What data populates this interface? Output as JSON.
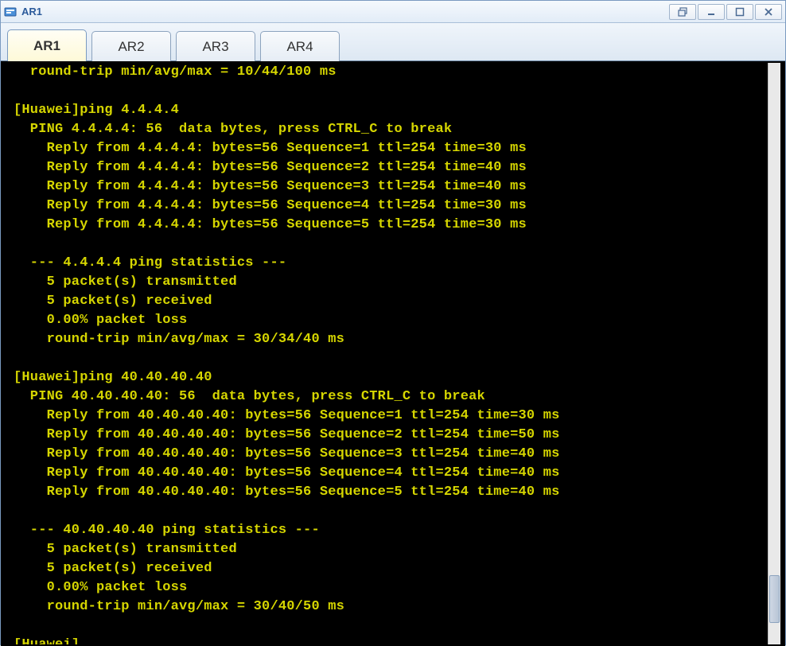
{
  "window": {
    "title": "AR1"
  },
  "tabs": [
    {
      "label": "AR1",
      "active": true
    },
    {
      "label": "AR2",
      "active": false
    },
    {
      "label": "AR3",
      "active": false
    },
    {
      "label": "AR4",
      "active": false
    }
  ],
  "terminal": {
    "partial_top": "  round-trip min/avg/max = 10/44/100 ms",
    "blocks": [
      {
        "prompt": "[Huawei]ping 4.4.4.4",
        "header": "  PING 4.4.4.4: 56  data bytes, press CTRL_C to break",
        "replies": [
          "    Reply from 4.4.4.4: bytes=56 Sequence=1 ttl=254 time=30 ms",
          "    Reply from 4.4.4.4: bytes=56 Sequence=2 ttl=254 time=40 ms",
          "    Reply from 4.4.4.4: bytes=56 Sequence=3 ttl=254 time=40 ms",
          "    Reply from 4.4.4.4: bytes=56 Sequence=4 ttl=254 time=30 ms",
          "    Reply from 4.4.4.4: bytes=56 Sequence=5 ttl=254 time=30 ms"
        ],
        "stats_header": "  --- 4.4.4.4 ping statistics ---",
        "stats": [
          "    5 packet(s) transmitted",
          "    5 packet(s) received",
          "    0.00% packet loss",
          "    round-trip min/avg/max = 30/34/40 ms"
        ]
      },
      {
        "prompt": "[Huawei]ping 40.40.40.40",
        "header": "  PING 40.40.40.40: 56  data bytes, press CTRL_C to break",
        "replies": [
          "    Reply from 40.40.40.40: bytes=56 Sequence=1 ttl=254 time=30 ms",
          "    Reply from 40.40.40.40: bytes=56 Sequence=2 ttl=254 time=50 ms",
          "    Reply from 40.40.40.40: bytes=56 Sequence=3 ttl=254 time=40 ms",
          "    Reply from 40.40.40.40: bytes=56 Sequence=4 ttl=254 time=40 ms",
          "    Reply from 40.40.40.40: bytes=56 Sequence=5 ttl=254 time=40 ms"
        ],
        "stats_header": "  --- 40.40.40.40 ping statistics ---",
        "stats": [
          "    5 packet(s) transmitted",
          "    5 packet(s) received",
          "    0.00% packet loss",
          "    round-trip min/avg/max = 30/40/50 ms"
        ]
      }
    ],
    "final_prompt": "[Huawei]"
  }
}
